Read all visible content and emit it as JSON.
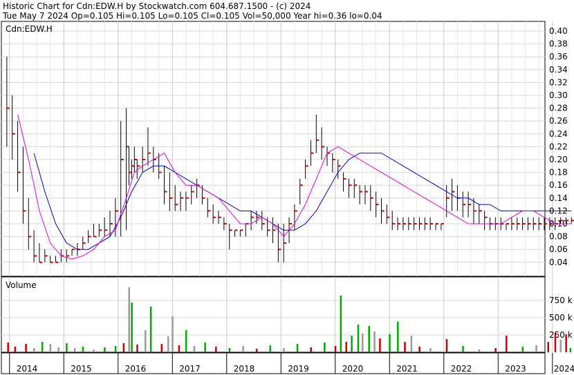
{
  "header": {
    "line1": "Historic Chart for Cdn:EDW.H by Stockwatch.com 604.687.1500 - (c) 2024",
    "line2": "Tue May  7 2024  Op=0.105  Hi=0.105  Lo=0.105  Cl=0.105  Vol=50,000  Year hi=0.36  lo=0.04"
  },
  "chart_data": [
    {
      "type": "line",
      "title": "Cdn:EDW.H",
      "ylim": [
        0.02,
        0.42
      ],
      "y_ticks": [
        "0.40",
        "0.38",
        "0.36",
        "0.34",
        "0.32",
        "0.30",
        "0.28",
        "0.26",
        "0.24",
        "0.22",
        "0.20",
        "0.18",
        "0.16",
        "0.14",
        "0.12",
        "0.10",
        "0.08",
        "0.06",
        "0.04"
      ],
      "x_labels": [
        "2014",
        "2015",
        "2016",
        "2017",
        "2018",
        "2019",
        "2020",
        "2021",
        "2022",
        "2023",
        "2024"
      ],
      "grid": true,
      "colors": {
        "price_bar": "#000000",
        "price_tick": "#cc0000",
        "ma_short": "#e000e0",
        "ma_long": "#0000cc"
      },
      "series": [
        {
          "style": "price",
          "x": [
            2013.95,
            2014.05,
            2014.15,
            2014.25,
            2014.35,
            2014.45,
            2014.55,
            2014.65,
            2014.75,
            2014.85,
            2014.95,
            2015.05,
            2015.15,
            2015.25,
            2015.35,
            2015.45,
            2015.55,
            2015.65,
            2015.75,
            2015.85,
            2015.95,
            2016.05,
            2016.15,
            2016.2,
            2016.25,
            2016.3,
            2016.35,
            2016.45,
            2016.55,
            2016.65,
            2016.75,
            2016.85,
            2016.95,
            2017.05,
            2017.15,
            2017.25,
            2017.35,
            2017.45,
            2017.55,
            2017.65,
            2017.75,
            2017.85,
            2017.95,
            2018.05,
            2018.15,
            2018.25,
            2018.35,
            2018.45,
            2018.55,
            2018.65,
            2018.75,
            2018.85,
            2018.95,
            2019.05,
            2019.15,
            2019.25,
            2019.35,
            2019.45,
            2019.55,
            2019.65,
            2019.75,
            2019.85,
            2019.95,
            2020.05,
            2020.15,
            2020.25,
            2020.35,
            2020.45,
            2020.55,
            2020.65,
            2020.75,
            2020.85,
            2020.95,
            2021.05,
            2021.15,
            2021.25,
            2021.35,
            2021.45,
            2021.55,
            2021.65,
            2021.75,
            2021.85,
            2021.95,
            2022.05,
            2022.15,
            2022.25,
            2022.35,
            2022.45,
            2022.55,
            2022.65,
            2022.75,
            2022.85,
            2022.95,
            2023.05,
            2023.15,
            2023.25,
            2023.35,
            2023.45,
            2023.55,
            2023.65,
            2023.75,
            2023.85,
            2023.95,
            2024.05,
            2024.15,
            2024.25,
            2024.35
          ],
          "high": [
            0.36,
            0.3,
            0.26,
            0.22,
            0.14,
            0.09,
            0.07,
            0.06,
            0.05,
            0.05,
            0.06,
            0.06,
            0.06,
            0.07,
            0.08,
            0.09,
            0.1,
            0.1,
            0.11,
            0.12,
            0.14,
            0.26,
            0.28,
            0.22,
            0.2,
            0.22,
            0.2,
            0.22,
            0.25,
            0.22,
            0.21,
            0.19,
            0.18,
            0.16,
            0.15,
            0.15,
            0.16,
            0.17,
            0.16,
            0.14,
            0.13,
            0.12,
            0.11,
            0.1,
            0.09,
            0.09,
            0.1,
            0.12,
            0.12,
            0.12,
            0.11,
            0.11,
            0.1,
            0.1,
            0.11,
            0.13,
            0.17,
            0.2,
            0.23,
            0.27,
            0.25,
            0.22,
            0.21,
            0.2,
            0.18,
            0.17,
            0.17,
            0.16,
            0.16,
            0.16,
            0.15,
            0.14,
            0.13,
            0.12,
            0.11,
            0.11,
            0.11,
            0.11,
            0.11,
            0.11,
            0.11,
            0.1,
            0.1,
            0.16,
            0.17,
            0.16,
            0.15,
            0.15,
            0.14,
            0.13,
            0.12,
            0.11,
            0.11,
            0.11,
            0.1,
            0.11,
            0.11,
            0.11,
            0.11,
            0.11,
            0.11,
            0.11,
            0.11,
            0.11,
            0.11,
            0.11,
            0.11
          ],
          "low": [
            0.22,
            0.2,
            0.15,
            0.1,
            0.06,
            0.04,
            0.04,
            0.04,
            0.04,
            0.04,
            0.04,
            0.04,
            0.05,
            0.05,
            0.06,
            0.07,
            0.08,
            0.08,
            0.08,
            0.08,
            0.08,
            0.08,
            0.09,
            0.16,
            0.17,
            0.18,
            0.17,
            0.18,
            0.19,
            0.18,
            0.17,
            0.13,
            0.12,
            0.12,
            0.12,
            0.12,
            0.13,
            0.14,
            0.13,
            0.11,
            0.1,
            0.1,
            0.09,
            0.06,
            0.08,
            0.08,
            0.08,
            0.09,
            0.1,
            0.09,
            0.08,
            0.07,
            0.04,
            0.04,
            0.07,
            0.09,
            0.13,
            0.17,
            0.19,
            0.21,
            0.2,
            0.19,
            0.18,
            0.17,
            0.15,
            0.14,
            0.14,
            0.13,
            0.13,
            0.12,
            0.11,
            0.1,
            0.1,
            0.09,
            0.09,
            0.09,
            0.09,
            0.09,
            0.09,
            0.09,
            0.09,
            0.09,
            0.09,
            0.11,
            0.12,
            0.12,
            0.11,
            0.11,
            0.1,
            0.1,
            0.09,
            0.09,
            0.09,
            0.09,
            0.09,
            0.09,
            0.09,
            0.09,
            0.09,
            0.09,
            0.09,
            0.09,
            0.09,
            0.09,
            0.1,
            0.1,
            0.1
          ],
          "close": [
            0.28,
            0.24,
            0.18,
            0.12,
            0.08,
            0.05,
            0.04,
            0.05,
            0.04,
            0.04,
            0.05,
            0.05,
            0.06,
            0.06,
            0.07,
            0.08,
            0.08,
            0.09,
            0.09,
            0.1,
            0.12,
            0.2,
            0.22,
            0.18,
            0.19,
            0.2,
            0.19,
            0.2,
            0.21,
            0.2,
            0.18,
            0.15,
            0.14,
            0.13,
            0.14,
            0.14,
            0.15,
            0.16,
            0.14,
            0.12,
            0.11,
            0.11,
            0.1,
            0.09,
            0.09,
            0.09,
            0.1,
            0.11,
            0.11,
            0.1,
            0.09,
            0.09,
            0.06,
            0.07,
            0.1,
            0.12,
            0.16,
            0.19,
            0.21,
            0.23,
            0.22,
            0.21,
            0.2,
            0.19,
            0.17,
            0.16,
            0.16,
            0.15,
            0.15,
            0.14,
            0.13,
            0.12,
            0.11,
            0.1,
            0.1,
            0.1,
            0.1,
            0.1,
            0.1,
            0.1,
            0.1,
            0.1,
            0.1,
            0.14,
            0.15,
            0.14,
            0.13,
            0.13,
            0.12,
            0.12,
            0.11,
            0.1,
            0.1,
            0.1,
            0.1,
            0.1,
            0.1,
            0.1,
            0.1,
            0.1,
            0.1,
            0.1,
            0.1,
            0.1,
            0.105,
            0.105,
            0.105
          ]
        },
        {
          "style": "ma_short",
          "x": [
            2014.15,
            2014.35,
            2014.55,
            2014.75,
            2014.95,
            2015.15,
            2015.35,
            2015.55,
            2015.75,
            2015.95,
            2016.15,
            2016.3,
            2016.45,
            2016.65,
            2016.85,
            2017.05,
            2017.25,
            2017.45,
            2017.65,
            2017.85,
            2018.05,
            2018.25,
            2018.45,
            2018.65,
            2018.85,
            2019.05,
            2019.25,
            2019.45,
            2019.65,
            2019.85,
            2020.05,
            2020.25,
            2020.45,
            2020.65,
            2020.85,
            2021.05,
            2021.25,
            2021.45,
            2021.65,
            2021.85,
            2022.05,
            2022.25,
            2022.45,
            2022.65,
            2022.85,
            2023.05,
            2023.25,
            2023.45,
            2023.65,
            2023.85,
            2024.05,
            2024.25,
            2024.35
          ],
          "values": [
            0.27,
            0.2,
            0.12,
            0.07,
            0.05,
            0.045,
            0.05,
            0.06,
            0.08,
            0.09,
            0.14,
            0.18,
            0.19,
            0.2,
            0.21,
            0.18,
            0.16,
            0.16,
            0.15,
            0.14,
            0.12,
            0.1,
            0.1,
            0.11,
            0.1,
            0.08,
            0.1,
            0.13,
            0.17,
            0.21,
            0.22,
            0.21,
            0.2,
            0.19,
            0.18,
            0.17,
            0.16,
            0.15,
            0.14,
            0.13,
            0.12,
            0.11,
            0.1,
            0.1,
            0.1,
            0.1,
            0.11,
            0.12,
            0.12,
            0.11,
            0.1,
            0.1,
            0.1
          ]
        },
        {
          "style": "ma_long",
          "x": [
            2014.45,
            2014.65,
            2014.85,
            2015.05,
            2015.25,
            2015.45,
            2015.65,
            2015.85,
            2016.05,
            2016.25,
            2016.45,
            2016.65,
            2016.85,
            2017.05,
            2017.25,
            2017.45,
            2017.65,
            2017.85,
            2018.05,
            2018.25,
            2018.45,
            2018.65,
            2018.85,
            2019.05,
            2019.25,
            2019.45,
            2019.65,
            2019.85,
            2020.05,
            2020.25,
            2020.45,
            2020.65,
            2020.85,
            2021.05,
            2021.25,
            2021.45,
            2021.65,
            2021.85,
            2022.05,
            2022.25,
            2022.45,
            2022.65,
            2022.85,
            2023.05,
            2023.25,
            2023.45,
            2023.65,
            2023.85,
            2024.05,
            2024.25,
            2024.35
          ],
          "values": [
            0.21,
            0.15,
            0.1,
            0.07,
            0.06,
            0.06,
            0.07,
            0.08,
            0.11,
            0.15,
            0.18,
            0.19,
            0.19,
            0.18,
            0.17,
            0.16,
            0.15,
            0.14,
            0.13,
            0.12,
            0.12,
            0.11,
            0.1,
            0.09,
            0.09,
            0.1,
            0.12,
            0.15,
            0.18,
            0.2,
            0.21,
            0.21,
            0.21,
            0.2,
            0.19,
            0.18,
            0.17,
            0.16,
            0.15,
            0.14,
            0.14,
            0.13,
            0.13,
            0.12,
            0.12,
            0.12,
            0.12,
            0.12,
            0.12,
            0.12,
            0.12
          ]
        }
      ]
    },
    {
      "type": "bar",
      "title": "Volume",
      "ylim": [
        0,
        1000000
      ],
      "y_ticks": [
        "750 k",
        "500 k",
        "250 k"
      ],
      "y_tick_values": [
        750000,
        500000,
        250000
      ],
      "colors": {
        "up": "#00aa00",
        "down": "#cc0000",
        "flat": "#999999"
      },
      "bars": [
        {
          "x": 2013.97,
          "v": 140000,
          "c": "down"
        },
        {
          "x": 2014.1,
          "v": 80000,
          "c": "down"
        },
        {
          "x": 2014.3,
          "v": 120000,
          "c": "down"
        },
        {
          "x": 2014.45,
          "v": 60000,
          "c": "flat"
        },
        {
          "x": 2014.6,
          "v": 150000,
          "c": "up"
        },
        {
          "x": 2014.75,
          "v": 120000,
          "c": "flat"
        },
        {
          "x": 2014.9,
          "v": 70000,
          "c": "flat"
        },
        {
          "x": 2015.05,
          "v": 130000,
          "c": "up"
        },
        {
          "x": 2015.2,
          "v": 60000,
          "c": "flat"
        },
        {
          "x": 2015.35,
          "v": 80000,
          "c": "up"
        },
        {
          "x": 2015.55,
          "v": 40000,
          "c": "flat"
        },
        {
          "x": 2015.75,
          "v": 70000,
          "c": "up"
        },
        {
          "x": 2015.95,
          "v": 90000,
          "c": "up"
        },
        {
          "x": 2016.1,
          "v": 130000,
          "c": "down"
        },
        {
          "x": 2016.2,
          "v": 940000,
          "c": "flat"
        },
        {
          "x": 2016.25,
          "v": 720000,
          "c": "up"
        },
        {
          "x": 2016.35,
          "v": 110000,
          "c": "down"
        },
        {
          "x": 2016.5,
          "v": 320000,
          "c": "flat"
        },
        {
          "x": 2016.6,
          "v": 660000,
          "c": "up"
        },
        {
          "x": 2016.8,
          "v": 120000,
          "c": "down"
        },
        {
          "x": 2016.92,
          "v": 230000,
          "c": "flat"
        },
        {
          "x": 2017.0,
          "v": 520000,
          "c": "flat"
        },
        {
          "x": 2017.12,
          "v": 100000,
          "c": "down"
        },
        {
          "x": 2017.25,
          "v": 320000,
          "c": "up"
        },
        {
          "x": 2017.4,
          "v": 90000,
          "c": "flat"
        },
        {
          "x": 2017.6,
          "v": 140000,
          "c": "up"
        },
        {
          "x": 2017.8,
          "v": 80000,
          "c": "down"
        },
        {
          "x": 2018.05,
          "v": 60000,
          "c": "up"
        },
        {
          "x": 2018.3,
          "v": 90000,
          "c": "flat"
        },
        {
          "x": 2018.55,
          "v": 50000,
          "c": "down"
        },
        {
          "x": 2018.8,
          "v": 100000,
          "c": "up"
        },
        {
          "x": 2019.05,
          "v": 60000,
          "c": "flat"
        },
        {
          "x": 2019.3,
          "v": 120000,
          "c": "up"
        },
        {
          "x": 2019.55,
          "v": 70000,
          "c": "down"
        },
        {
          "x": 2019.8,
          "v": 140000,
          "c": "up"
        },
        {
          "x": 2020.0,
          "v": 90000,
          "c": "down"
        },
        {
          "x": 2020.1,
          "v": 820000,
          "c": "up"
        },
        {
          "x": 2020.2,
          "v": 150000,
          "c": "down"
        },
        {
          "x": 2020.3,
          "v": 240000,
          "c": "up"
        },
        {
          "x": 2020.42,
          "v": 400000,
          "c": "up"
        },
        {
          "x": 2020.5,
          "v": 270000,
          "c": "flat"
        },
        {
          "x": 2020.62,
          "v": 380000,
          "c": "up"
        },
        {
          "x": 2020.72,
          "v": 300000,
          "c": "flat"
        },
        {
          "x": 2020.82,
          "v": 200000,
          "c": "down"
        },
        {
          "x": 2021.0,
          "v": 260000,
          "c": "up"
        },
        {
          "x": 2021.15,
          "v": 440000,
          "c": "up"
        },
        {
          "x": 2021.28,
          "v": 150000,
          "c": "down"
        },
        {
          "x": 2021.4,
          "v": 240000,
          "c": "flat"
        },
        {
          "x": 2021.55,
          "v": 80000,
          "c": "down"
        },
        {
          "x": 2021.75,
          "v": 60000,
          "c": "flat"
        },
        {
          "x": 2022.05,
          "v": 190000,
          "c": "down"
        },
        {
          "x": 2022.35,
          "v": 90000,
          "c": "up"
        },
        {
          "x": 2022.65,
          "v": 40000,
          "c": "flat"
        },
        {
          "x": 2022.95,
          "v": 60000,
          "c": "down"
        },
        {
          "x": 2023.15,
          "v": 240000,
          "c": "down"
        },
        {
          "x": 2023.45,
          "v": 80000,
          "c": "up"
        },
        {
          "x": 2023.7,
          "v": 100000,
          "c": "flat"
        },
        {
          "x": 2023.92,
          "v": 150000,
          "c": "down"
        },
        {
          "x": 2024.05,
          "v": 280000,
          "c": "down"
        },
        {
          "x": 2024.15,
          "v": 180000,
          "c": "flat"
        },
        {
          "x": 2024.25,
          "v": 260000,
          "c": "down"
        },
        {
          "x": 2024.33,
          "v": 60000,
          "c": "up"
        }
      ]
    }
  ]
}
